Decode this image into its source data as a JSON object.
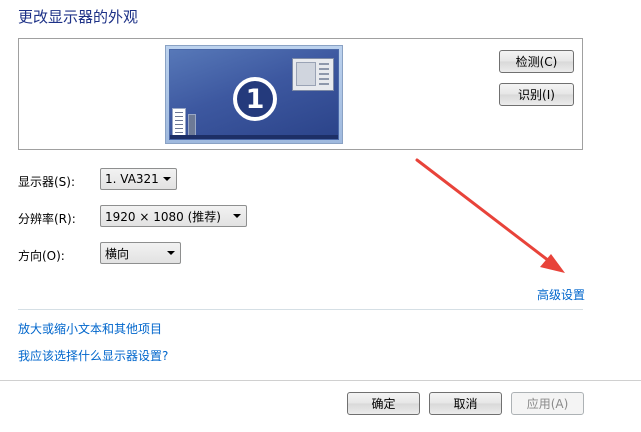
{
  "page": {
    "title": "更改显示器的外观"
  },
  "preview": {
    "monitor_number": "1",
    "detect_label": "检测(C)",
    "identify_label": "识别(I)"
  },
  "form": {
    "display_label": "显示器(S):",
    "display_value": "1. VA321",
    "resolution_label": "分辨率(R):",
    "resolution_value": "1920 × 1080 (推荐)",
    "orientation_label": "方向(O):",
    "orientation_value": "横向"
  },
  "links": {
    "advanced_settings": "高级设置",
    "enlarge_text": "放大或缩小文本和其他项目",
    "which_settings": "我应该选择什么显示器设置?"
  },
  "footer": {
    "ok_label": "确定",
    "cancel_label": "取消",
    "apply_label": "应用(A)"
  },
  "colors": {
    "title": "#1e3287",
    "link": "#0066cc",
    "annotation_arrow": "#e8433a"
  }
}
